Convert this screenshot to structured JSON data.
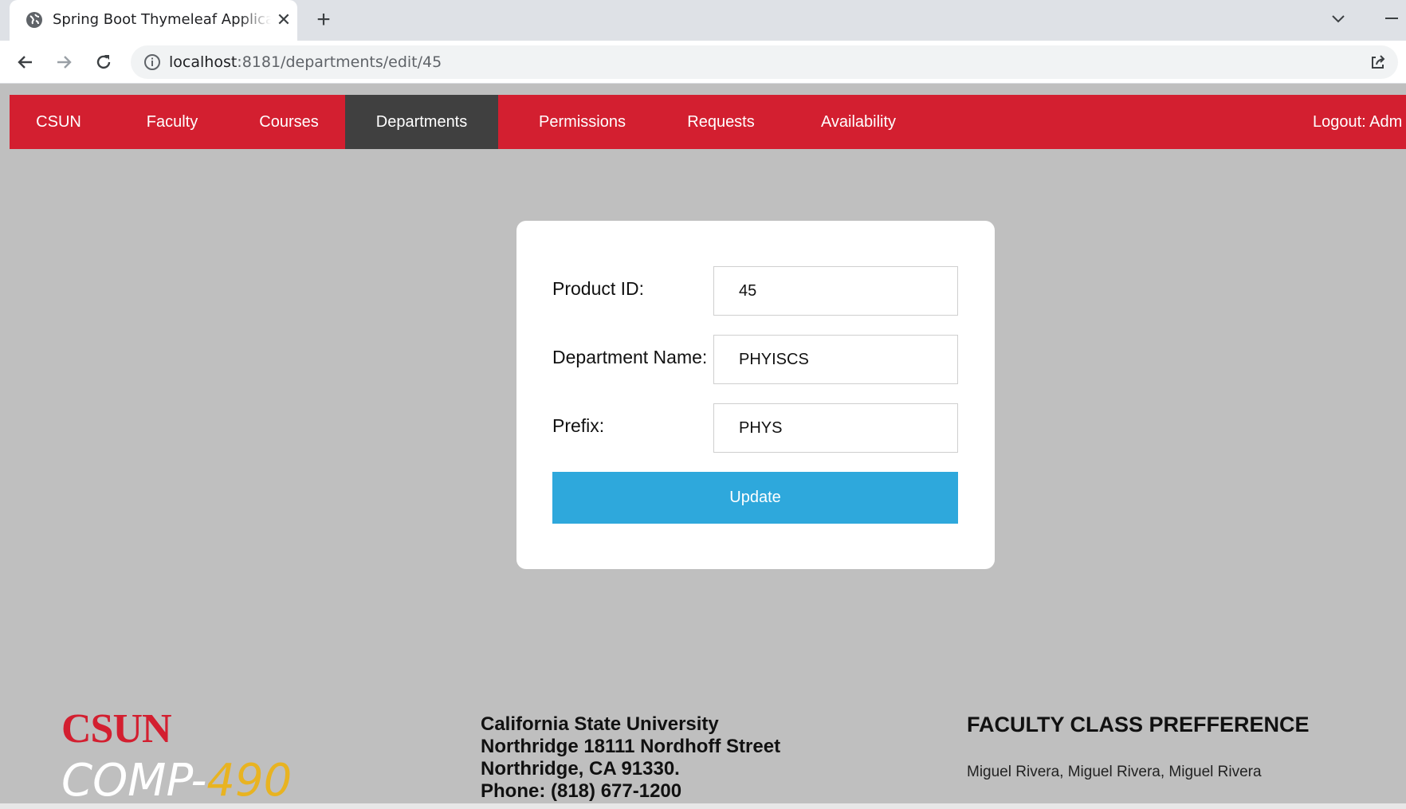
{
  "browser": {
    "tab_title": "Spring Boot Thymeleaf Application",
    "url_host": "localhost",
    "url_rest": ":8181/departments/edit/45",
    "icons": [
      "globe-icon",
      "close-icon",
      "plus-icon",
      "chevron-down-icon",
      "minimize-icon",
      "back-arrow-icon",
      "forward-arrow-icon",
      "reload-icon",
      "info-icon",
      "share-icon"
    ]
  },
  "nav": {
    "items": [
      {
        "label": "CSUN"
      },
      {
        "label": "Faculty"
      },
      {
        "label": "Courses"
      },
      {
        "label": "Departments",
        "active": true
      },
      {
        "label": "Permissions"
      },
      {
        "label": "Requests"
      },
      {
        "label": "Availability"
      }
    ],
    "logout": "Logout: Adm"
  },
  "form": {
    "id_label": "Product ID:",
    "id_value": "45",
    "name_label": "Department Name:",
    "name_value": "PHYISCS",
    "prefix_label": "Prefix:",
    "prefix_value": "PHYS",
    "submit": "Update"
  },
  "footer": {
    "logo": "CSUN",
    "course_prefix": "COMP-",
    "course_number": "490",
    "address": [
      "California State University",
      "Northridge 18111 Nordhoff Street",
      "Northridge, CA 91330.",
      "Phone: (818) 677-1200"
    ],
    "project_title": "FACULTY CLASS PREFFERENCE",
    "authors": "Miguel Rivera, Miguel Rivera, Miguel Rivera"
  },
  "colors": {
    "nav_red": "#d31f30",
    "nav_active": "#404040",
    "page_bg": "#bfbfbf",
    "button_blue": "#2ea8dc",
    "course_gold": "#e8b321"
  }
}
